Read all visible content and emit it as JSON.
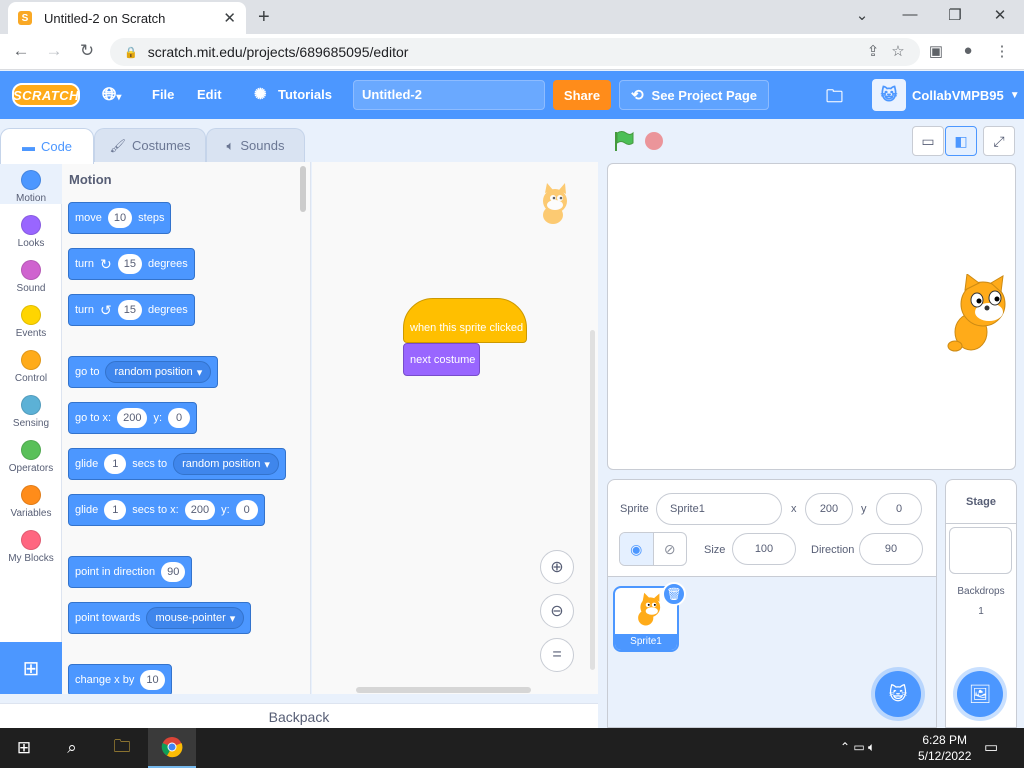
{
  "browser": {
    "tab_title": "Untitled-2 on Scratch",
    "tab_favicon": "S",
    "url": "scratch.mit.edu/projects/689685095/editor"
  },
  "menubar": {
    "logo": "SCRATCH",
    "file": "File",
    "edit": "Edit",
    "tutorials": "Tutorials",
    "project_title": "Untitled-2",
    "share": "Share",
    "see_project_page": "See Project Page",
    "username": "CollabVMPB95"
  },
  "tabs": {
    "code": "Code",
    "costumes": "Costumes",
    "sounds": "Sounds"
  },
  "categories": [
    {
      "label": "Motion",
      "color": "#4c97ff"
    },
    {
      "label": "Looks",
      "color": "#9966ff"
    },
    {
      "label": "Sound",
      "color": "#cf63cf"
    },
    {
      "label": "Events",
      "color": "#ffd500"
    },
    {
      "label": "Control",
      "color": "#ffab19"
    },
    {
      "label": "Sensing",
      "color": "#5cb1d6"
    },
    {
      "label": "Operators",
      "color": "#59c059"
    },
    {
      "label": "Variables",
      "color": "#ff8c1a"
    },
    {
      "label": "My Blocks",
      "color": "#ff6680"
    }
  ],
  "palette": {
    "title": "Motion",
    "move": {
      "a": "move",
      "v": "10",
      "b": "steps"
    },
    "turn_right": {
      "a": "turn",
      "v": "15",
      "b": "degrees"
    },
    "turn_left": {
      "a": "turn",
      "v": "15",
      "b": "degrees"
    },
    "goto": {
      "a": "go to",
      "opt": "random position"
    },
    "gotoxy": {
      "a": "go to x:",
      "x": "200",
      "b": "y:",
      "y": "0"
    },
    "glide_to": {
      "a": "glide",
      "v": "1",
      "b": "secs to",
      "opt": "random position"
    },
    "glide_xy": {
      "a": "glide",
      "v": "1",
      "b": "secs to x:",
      "x": "200",
      "c": "y:",
      "y": "0"
    },
    "point_dir": {
      "a": "point in direction",
      "v": "90"
    },
    "point_towards": {
      "a": "point towards",
      "opt": "mouse-pointer"
    },
    "change_x": {
      "a": "change x by",
      "v": "10"
    }
  },
  "script": {
    "hat": "when this sprite clicked",
    "looks": "next costume"
  },
  "backpack": "Backpack",
  "sprite_info": {
    "sprite_label": "Sprite",
    "sprite_name": "Sprite1",
    "x_label": "x",
    "x": "200",
    "y_label": "y",
    "y": "0",
    "size_label": "Size",
    "size": "100",
    "direction_label": "Direction",
    "direction": "90"
  },
  "sprites": [
    {
      "name": "Sprite1"
    }
  ],
  "stage_panel": {
    "title": "Stage",
    "backdrops_label": "Backdrops",
    "backdrops_count": "1"
  },
  "taskbar": {
    "time": "6:28 PM",
    "date": "5/12/2022"
  }
}
